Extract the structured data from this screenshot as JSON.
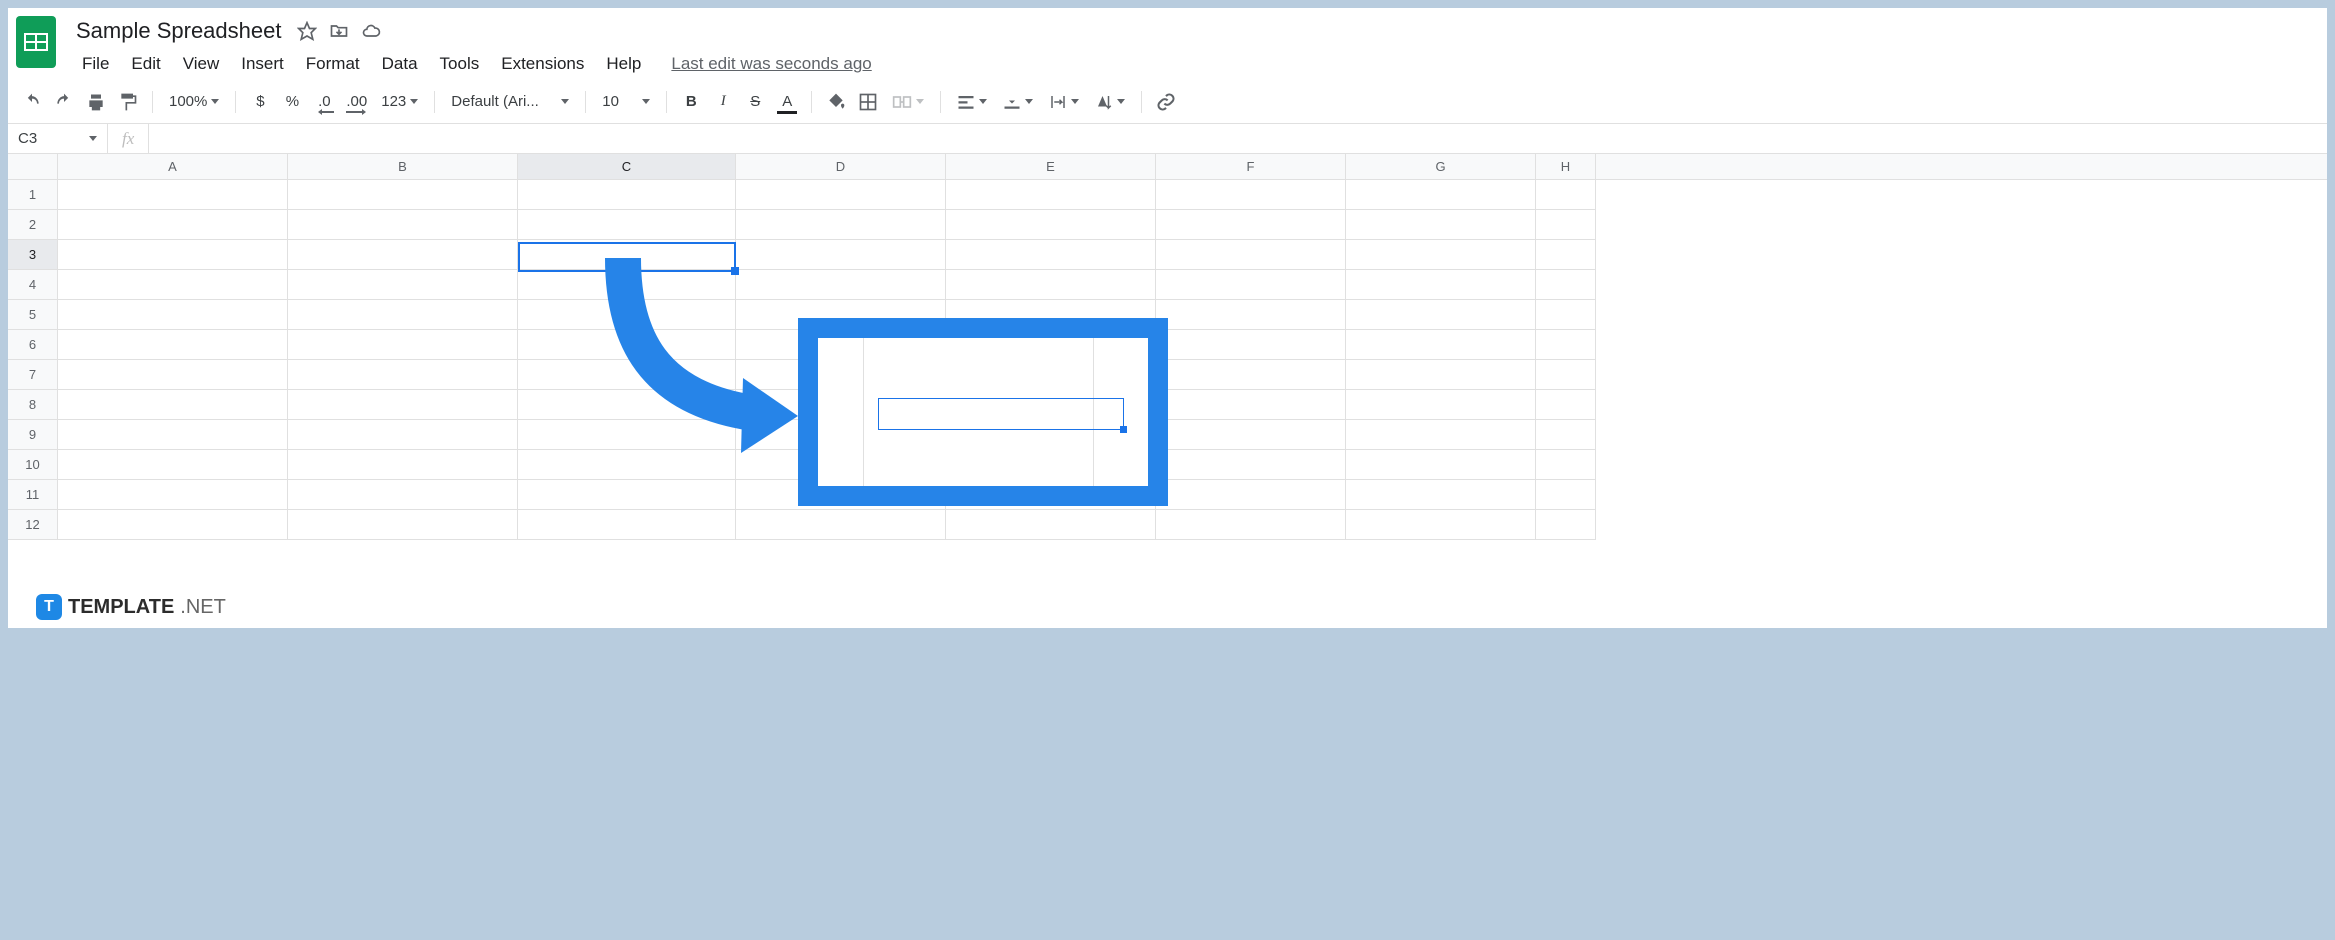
{
  "doc": {
    "title": "Sample Spreadsheet"
  },
  "menu": {
    "file": "File",
    "edit": "Edit",
    "view": "View",
    "insert": "Insert",
    "format": "Format",
    "data": "Data",
    "tools": "Tools",
    "extensions": "Extensions",
    "help": "Help",
    "last_edit": "Last edit was seconds ago"
  },
  "toolbar": {
    "zoom": "100%",
    "currency": "$",
    "percent": "%",
    "dec_dec": ".0",
    "inc_dec": ".00",
    "more_formats": "123",
    "font": "Default (Ari...",
    "font_size": "10",
    "bold": "B",
    "italic": "I",
    "strike": "S",
    "text_color": "A"
  },
  "namebox": {
    "value": "C3"
  },
  "fx": {
    "label": "fx"
  },
  "columns": [
    "A",
    "B",
    "C",
    "D",
    "E",
    "F",
    "G",
    "H"
  ],
  "rows": [
    "1",
    "2",
    "3",
    "4",
    "5",
    "6",
    "7",
    "8",
    "9",
    "10",
    "11",
    "12"
  ],
  "active_cell": "C3",
  "watermark": {
    "badge": "T",
    "text": "TEMPLATE",
    "suffix": ".NET"
  }
}
